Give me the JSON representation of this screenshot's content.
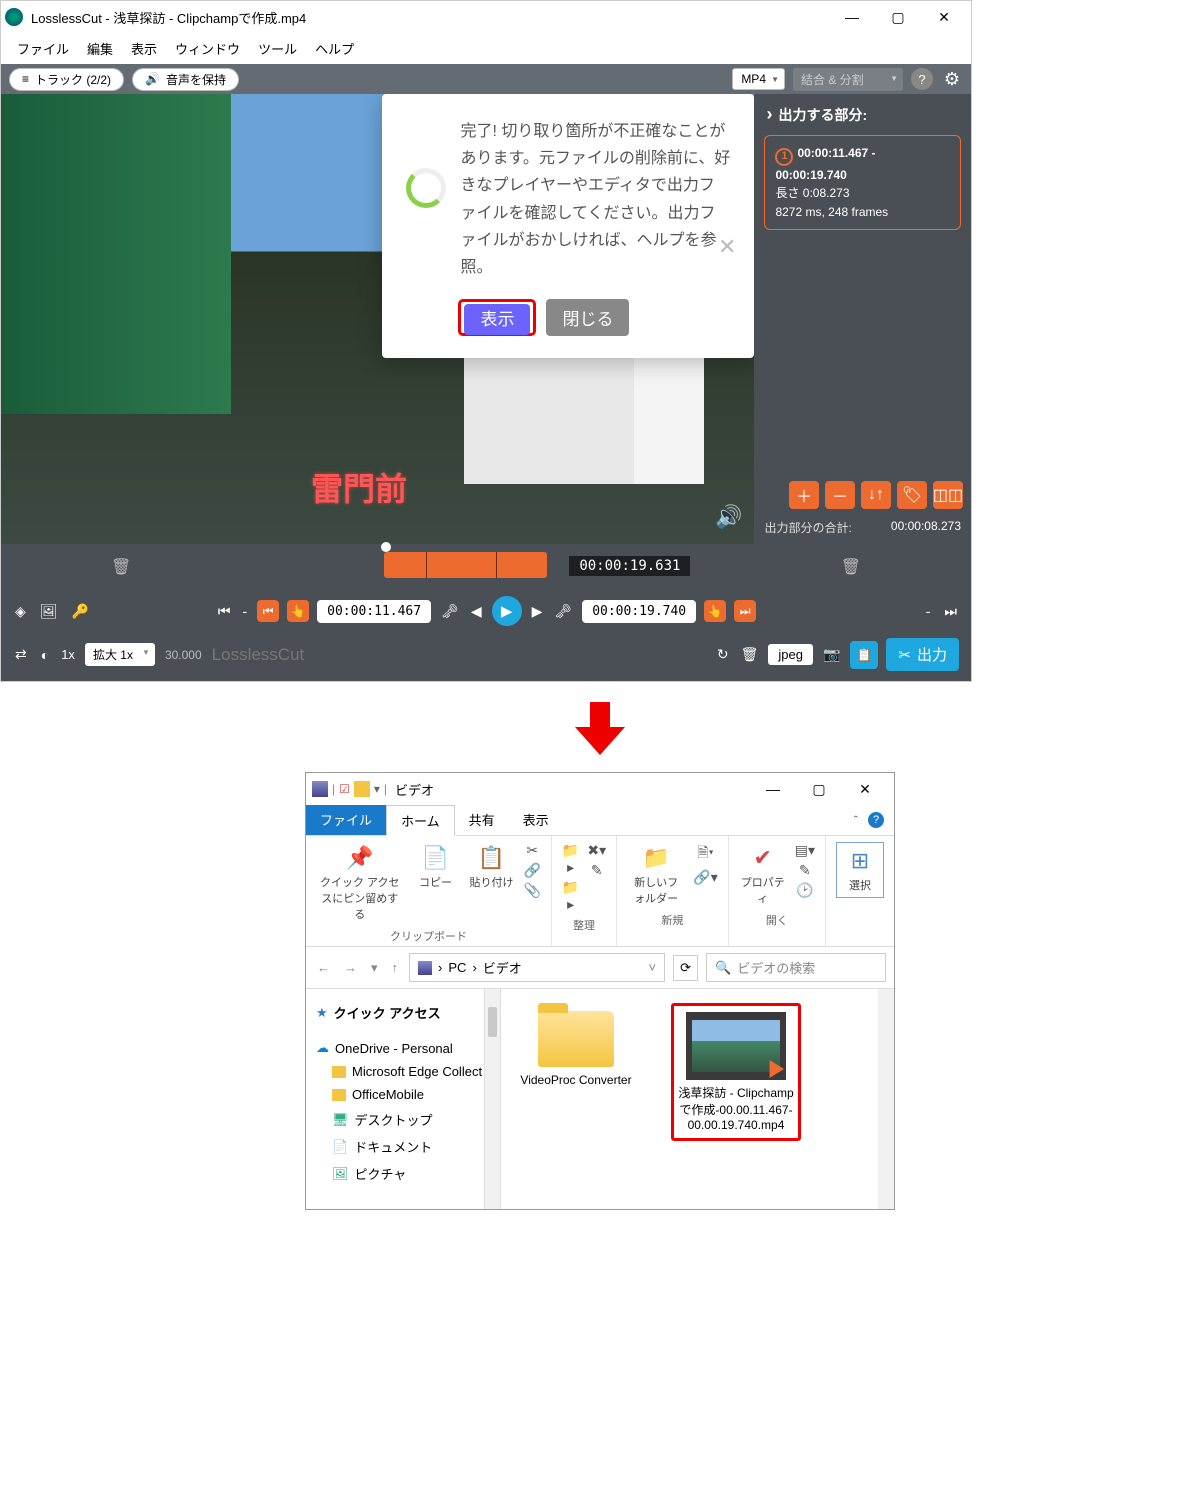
{
  "lc": {
    "title": "LosslessCut - 浅草探訪 - Clipchampで作成.mp4",
    "menu": [
      "ファイル",
      "編集",
      "表示",
      "ウィンドウ",
      "ツール",
      "ヘルプ"
    ],
    "toolbar": {
      "track": "トラック (2/2)",
      "keepAudio": "音声を保持",
      "format": "MP4",
      "mergeSplit": "結合 & 分割"
    },
    "dialog": {
      "msg": "完了! 切り取り箇所が不正確なことがあります。元ファイルの削除前に、好きなプレイヤーやエディタで出力ファイルを確認してください。出力ファイルがおかしければ、ヘルプを参照。",
      "show": "表示",
      "close": "閉じる"
    },
    "videoOverlay": "雷門前",
    "right": {
      "head": "出力する部分:",
      "badge": "1",
      "range": "00:00:11.467 - 00:00:19.740",
      "lenLabel": "長さ 0:08.273",
      "msFrames": "8272 ms, 248 frames",
      "totalLabel": "出力部分の合計:",
      "totalValue": "00:00:08.273"
    },
    "timeline": {
      "pos": "00:00:19.631"
    },
    "ctl": {
      "start": "00:00:11.467",
      "end": "00:00:19.740",
      "speed": "1x",
      "zoom": "拡大 1x",
      "fps": "30.000",
      "watermark": "LosslessCut",
      "capFmt": "jpeg",
      "export": "出力"
    }
  },
  "exp": {
    "title": "ビデオ",
    "tabs": {
      "file": "ファイル",
      "home": "ホーム",
      "share": "共有",
      "view": "表示"
    },
    "ribbon": {
      "pin": "クイック アクセスにピン留めする",
      "copy": "コピー",
      "paste": "貼り付け",
      "newFolder": "新しいフォルダー",
      "properties": "プロパティ",
      "select": "選択",
      "gClipboard": "クリップボード",
      "gOrganize": "整理",
      "gNew": "新規",
      "gOpen": "開く"
    },
    "path": {
      "pc": "PC",
      "folder": "ビデオ",
      "searchPlaceholder": "ビデオの検索"
    },
    "tree": {
      "quick": "クイック アクセス",
      "onedrive": "OneDrive - Personal",
      "items": [
        "Microsoft Edge Collect",
        "OfficeMobile",
        "デスクトップ",
        "ドキュメント",
        "ピクチャ"
      ]
    },
    "files": {
      "folder1": "VideoProc Converter",
      "video1": "浅草探訪 - Clipchampで作成-00.00.11.467-00.00.19.740.mp4"
    }
  }
}
